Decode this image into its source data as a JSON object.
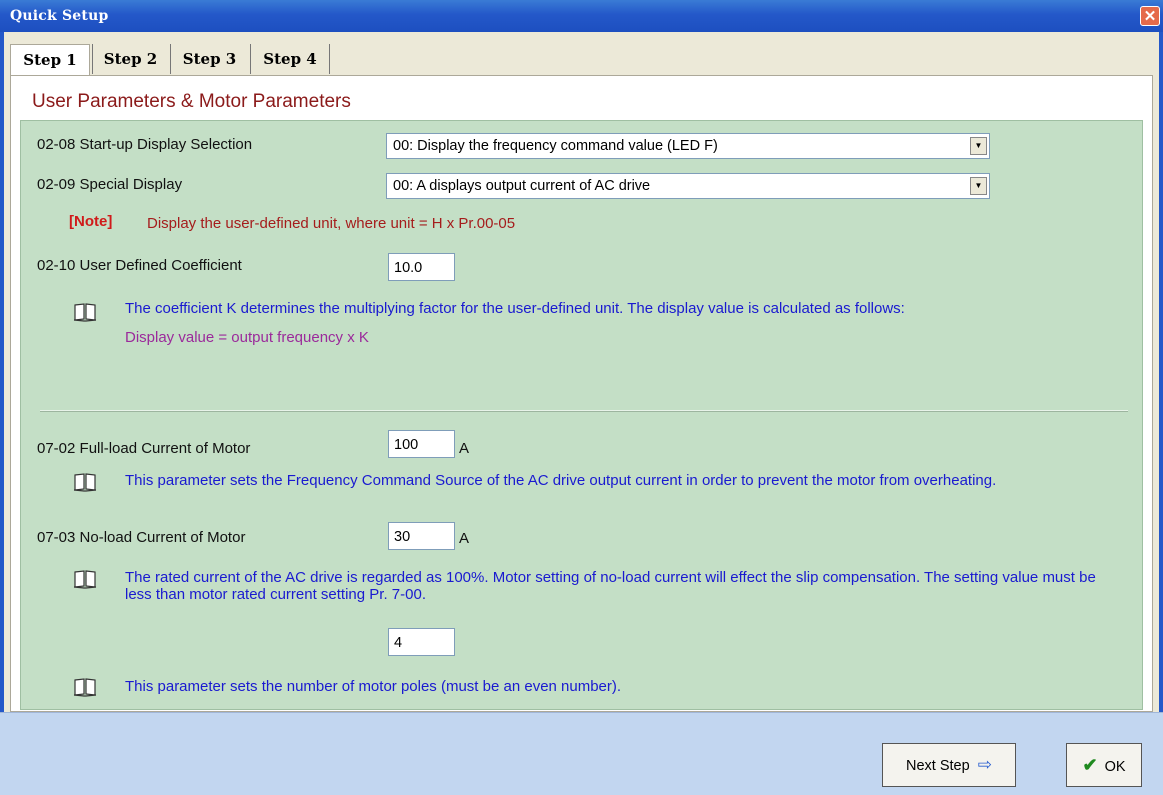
{
  "window": {
    "title": "Quick Setup",
    "close_glyph": "✕"
  },
  "tabs": [
    {
      "label": "Step 1",
      "active": true
    },
    {
      "label": "Step 2",
      "active": false
    },
    {
      "label": "Step 3",
      "active": false
    },
    {
      "label": "Step 4",
      "active": false
    }
  ],
  "section_title": "User Parameters & Motor Parameters",
  "params": {
    "p0208": {
      "label": "02-08 Start-up Display Selection",
      "value": "00: Display the frequency command value (LED F)"
    },
    "p0209": {
      "label": "02-09 Special Display",
      "value": "00: A displays output current of AC drive"
    },
    "note": {
      "tag": "[Note]",
      "text": "Display the user-defined unit, where unit = H x Pr.00-05"
    },
    "p0210": {
      "label": "02-10 User Defined Coefficient",
      "value": "10.0",
      "info": "The coefficient K determines the multiplying factor for the user-defined unit. The display value is calculated as follows:",
      "formula": "Display value = output frequency x K"
    },
    "p0702": {
      "label": "07-02 Full-load Current of Motor",
      "value": "100",
      "unit": "A",
      "info": "This parameter sets the Frequency Command Source of the AC drive output current in order to prevent the motor from overheating."
    },
    "p0703": {
      "label": "07-03 No-load Current of Motor",
      "value": "30",
      "unit": "A",
      "info": "The rated current of the AC drive is regarded as 100%. Motor setting of no-load current will effect the slip compensation. The setting value must be less than motor rated current setting Pr. 7-00."
    },
    "poles": {
      "value": "4",
      "info": "This parameter sets the number of motor poles (must be an even number)."
    }
  },
  "buttons": {
    "next_label": "Next Step",
    "next_icon": "⇨",
    "ok_label": "OK",
    "ok_icon": "✔"
  },
  "colors": {
    "title_bar": "#2458c9",
    "panel_green": "#c4dfc6",
    "footer": "#c2d6f0",
    "heading": "#8b1a1a",
    "info_text": "#1a1ad0",
    "formula_text": "#9b2a9b",
    "note_tag": "#d01a1a"
  }
}
